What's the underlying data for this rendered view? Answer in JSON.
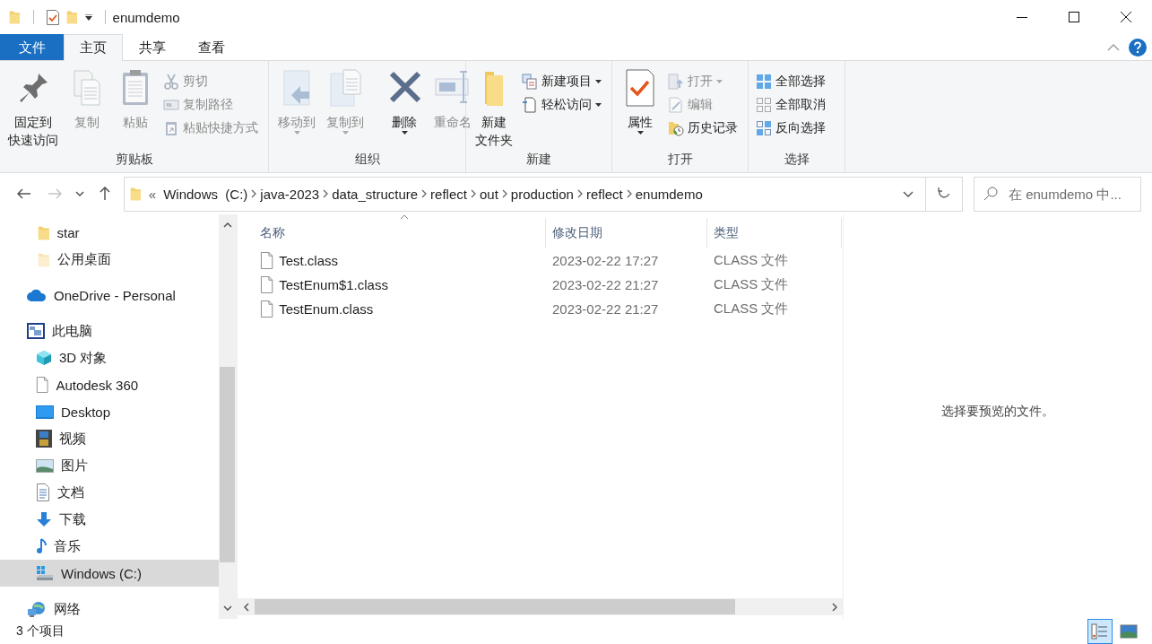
{
  "window": {
    "title": "enumdemo"
  },
  "ribbon_tabs": [
    {
      "label": "文件",
      "kind": "file",
      "selected": false
    },
    {
      "label": "主页",
      "kind": "tab",
      "selected": true
    },
    {
      "label": "共享",
      "kind": "tab",
      "selected": false
    },
    {
      "label": "查看",
      "kind": "tab",
      "selected": false
    }
  ],
  "ribbon_groups": [
    {
      "label": "剪贴板",
      "items": [
        {
          "kind": "large",
          "label": [
            "固定到",
            "快速访问"
          ],
          "disabled": false,
          "menu": false
        },
        {
          "kind": "large",
          "label": "复制",
          "disabled": true,
          "menu": false
        },
        {
          "kind": "large",
          "label": "粘贴",
          "disabled": true,
          "menu": false
        },
        {
          "kind": "small",
          "label": "剪切",
          "disabled": true,
          "menu": false
        },
        {
          "kind": "small",
          "label": "复制路径",
          "disabled": true,
          "menu": false
        },
        {
          "kind": "small",
          "label": "粘贴快捷方式",
          "disabled": true,
          "menu": false
        }
      ]
    },
    {
      "label": "组织",
      "items": [
        {
          "kind": "large",
          "label": "移动到",
          "disabled": true,
          "menu": true
        },
        {
          "kind": "large",
          "label": "复制到",
          "disabled": true,
          "menu": true
        },
        {
          "kind": "separator"
        },
        {
          "kind": "large",
          "label": "删除",
          "disabled": false,
          "menu": true
        },
        {
          "kind": "large",
          "label": "重命名",
          "disabled": true,
          "menu": false
        }
      ]
    },
    {
      "label": "新建",
      "items": [
        {
          "kind": "large",
          "label": [
            "新建",
            "文件夹"
          ],
          "disabled": false,
          "menu": false
        },
        {
          "kind": "small",
          "label": "新建项目",
          "disabled": false,
          "menu": true
        },
        {
          "kind": "small",
          "label": "轻松访问",
          "disabled": false,
          "menu": true
        }
      ]
    },
    {
      "label": "打开",
      "items": [
        {
          "kind": "large",
          "label": "属性",
          "disabled": false,
          "menu": true
        },
        {
          "kind": "small",
          "label": "打开",
          "disabled": true,
          "menu": true
        },
        {
          "kind": "small",
          "label": "编辑",
          "disabled": true,
          "menu": false
        },
        {
          "kind": "small",
          "label": "历史记录",
          "disabled": false,
          "menu": false
        }
      ]
    },
    {
      "label": "选择",
      "items": [
        {
          "kind": "small",
          "label": "全部选择",
          "disabled": false,
          "menu": false
        },
        {
          "kind": "small",
          "label": "全部取消",
          "disabled": false,
          "menu": false
        },
        {
          "kind": "small",
          "label": "反向选择",
          "disabled": false,
          "menu": false
        }
      ]
    }
  ],
  "nav_buttons": [
    {
      "kind": "back",
      "disabled": false
    },
    {
      "kind": "forward",
      "disabled": true
    },
    {
      "kind": "recent",
      "disabled": false
    },
    {
      "kind": "up",
      "disabled": false
    }
  ],
  "address_bar": {
    "overflow_mark": "«",
    "segments": [
      "Windows  (C:)",
      "java-2023",
      "data_structure",
      "reflect",
      "out",
      "production",
      "reflect",
      "enumdemo"
    ]
  },
  "search": {
    "placeholder": "在 enumdemo 中..."
  },
  "navigation_pane": {
    "pinned": [
      {
        "label": "star",
        "selected": false
      },
      {
        "label": "公用桌面",
        "selected": false
      }
    ],
    "sections": [
      {
        "label": "OneDrive - Personal",
        "selected": false
      },
      {
        "label": "此电脑",
        "selected": false,
        "children": [
          {
            "label": "3D 对象",
            "selected": false
          },
          {
            "label": "Autodesk 360",
            "selected": false
          },
          {
            "label": "Desktop",
            "selected": false
          },
          {
            "label": "视频",
            "selected": false
          },
          {
            "label": "图片",
            "selected": false
          },
          {
            "label": "文档",
            "selected": false
          },
          {
            "label": "下载",
            "selected": false
          },
          {
            "label": "音乐",
            "selected": false
          },
          {
            "label": "Windows  (C:)",
            "selected": true
          }
        ]
      },
      {
        "label": "网络",
        "selected": false
      }
    ]
  },
  "file_list": {
    "columns": [
      {
        "label": "名称",
        "sorted": true
      },
      {
        "label": "修改日期",
        "sorted": false
      },
      {
        "label": "类型",
        "sorted": false
      }
    ],
    "rows": [
      {
        "name": "Test.class",
        "modified": "2023-02-22 17:27",
        "type": "CLASS 文件"
      },
      {
        "name": "TestEnum$1.class",
        "modified": "2023-02-22 21:27",
        "type": "CLASS 文件"
      },
      {
        "name": "TestEnum.class",
        "modified": "2023-02-22 21:27",
        "type": "CLASS 文件"
      }
    ]
  },
  "preview_pane": {
    "message": "选择要预览的文件。"
  },
  "status_bar": {
    "item_count": "3 个项目",
    "views": [
      {
        "kind": "details",
        "selected": true
      },
      {
        "kind": "large_icons",
        "selected": false
      }
    ]
  }
}
